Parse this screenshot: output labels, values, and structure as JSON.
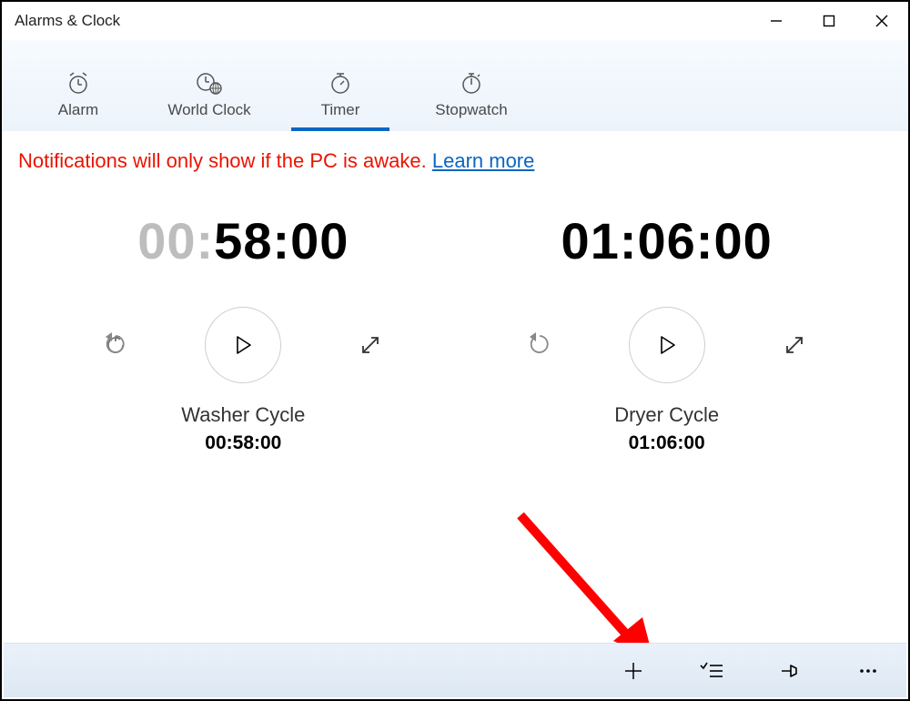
{
  "window": {
    "title": "Alarms & Clock"
  },
  "tabs": {
    "items": [
      {
        "label": "Alarm",
        "selected": false
      },
      {
        "label": "World Clock",
        "selected": false
      },
      {
        "label": "Timer",
        "selected": true
      },
      {
        "label": "Stopwatch",
        "selected": false
      }
    ]
  },
  "notification": {
    "text": "Notifications will only show if the PC is awake. ",
    "link_label": "Learn more"
  },
  "timers": [
    {
      "hh": "00",
      "mm": "58",
      "ss": "00",
      "grey_hours": true,
      "name": "Washer Cycle",
      "duration": "00:58:00"
    },
    {
      "hh": "01",
      "mm": "06",
      "ss": "00",
      "grey_hours": false,
      "name": "Dryer Cycle",
      "duration": "01:06:00"
    }
  ],
  "bottom_actions": {
    "add": "+",
    "list": "≡",
    "pin": "📌",
    "more": "⋯"
  }
}
